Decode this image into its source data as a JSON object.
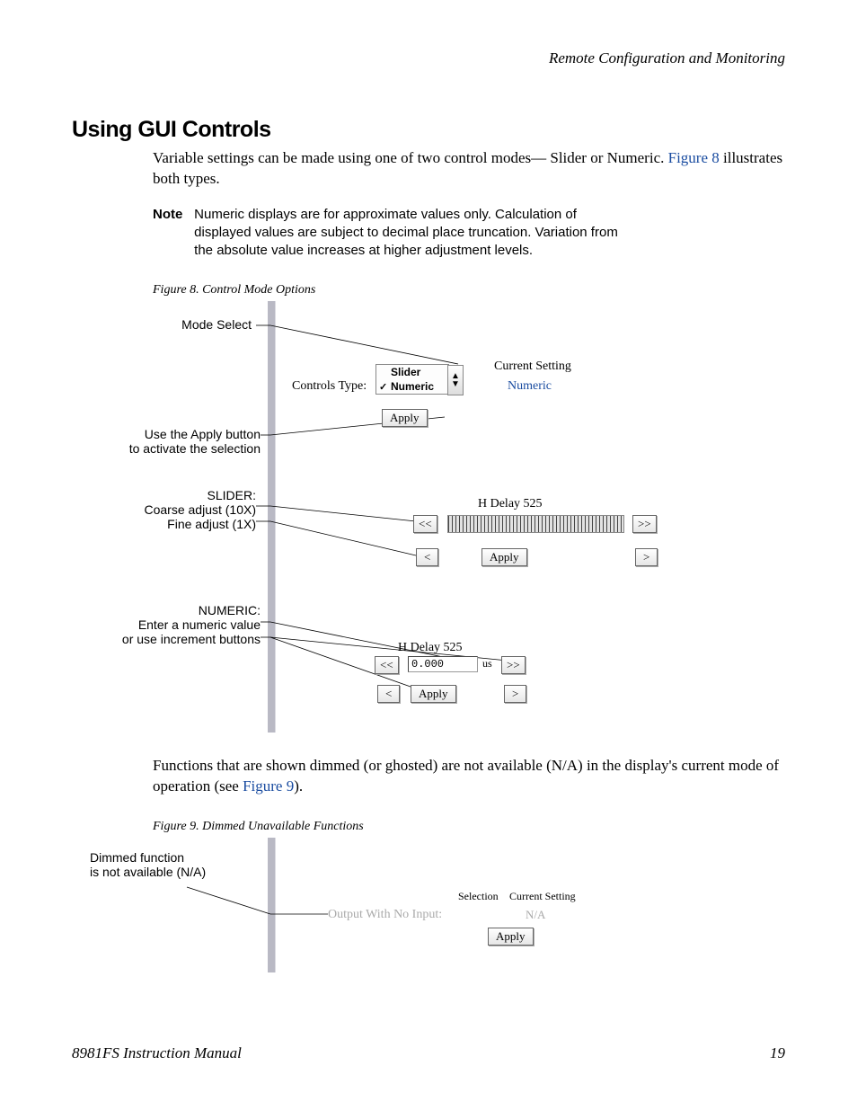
{
  "header": {
    "section_title": "Remote Configuration and Monitoring"
  },
  "heading": "Using GUI Controls",
  "para1_a": "Variable settings can be made using one of two control modes— Slider or Numeric. ",
  "para1_link": "Figure 8",
  "para1_b": " illustrates both types.",
  "note": {
    "label": "Note",
    "text": "Numeric displays are for approximate values only. Calculation of displayed values are subject to decimal place truncation. Variation from the absolute value increases at higher adjustment levels."
  },
  "figure8": {
    "caption": "Figure 8.  Control Mode Options",
    "anno_mode": "Mode Select",
    "anno_apply": "Use the Apply button\nto activate the selection",
    "anno_slider": "SLIDER:\nCoarse adjust (10X)\nFine adjust (1X)",
    "anno_numeric": "NUMERIC:\nEnter a numeric value\nor use increment buttons",
    "controls_type_label": "Controls Type:",
    "dd_option1": "Slider",
    "dd_option2": "Numeric",
    "current_setting_hdr": "Current Setting",
    "current_setting_val": "Numeric",
    "apply_label": "Apply",
    "slider_title": "H Delay 525",
    "coarse_left": "<<",
    "coarse_right": ">>",
    "fine_left": "<",
    "fine_right": ">",
    "numeric_title": "H Delay 525",
    "numeric_value": "0.000",
    "numeric_unit": "us"
  },
  "para2_a": "Functions that are shown dimmed (or ghosted) are not available (N/A) in the display's current mode of operation (see ",
  "para2_link": "Figure 9",
  "para2_b": ").",
  "figure9": {
    "caption": "Figure 9.  Dimmed Unavailable Functions",
    "anno": "Dimmed function\nis not available (N/A)",
    "row_label": "Output With No Input:",
    "selection_hdr": "Selection",
    "current_hdr": "Current Setting",
    "na": "N/A",
    "apply": "Apply"
  },
  "footer": {
    "left": "8981FS Instruction Manual",
    "right": "19"
  }
}
